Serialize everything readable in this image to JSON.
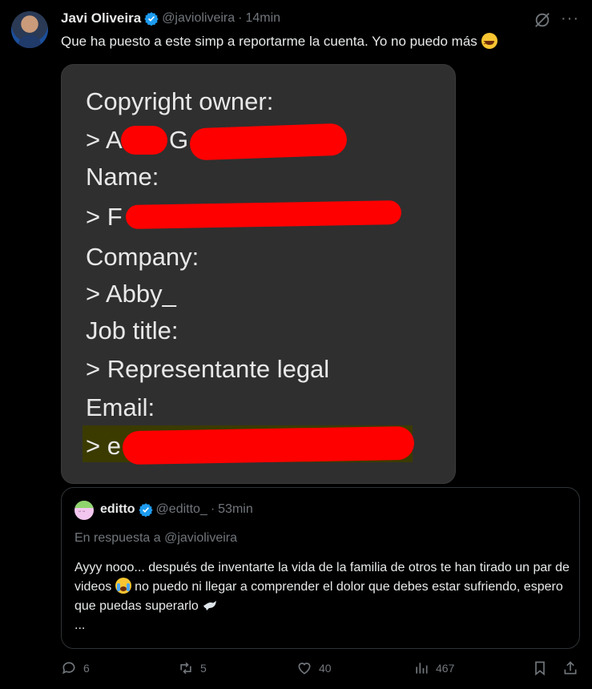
{
  "tweet": {
    "author_name": "Javi Oliveira",
    "author_handle": "@javioliveira",
    "separator": "·",
    "timestamp": "14min",
    "text": "Que ha puesto a este simp a reportarme la cuenta. Yo no puedo más",
    "emoji": "laughing-emoji"
  },
  "media": {
    "lines": [
      "Copyright owner:",
      "> A",
      "G",
      "Name:",
      "> F",
      "Company:",
      "> Abby_",
      "Job title:",
      "> Representante legal",
      "Email:",
      "> e"
    ],
    "redaction_color": "#ff0000"
  },
  "quote": {
    "author_name": "editto",
    "author_handle": "@editto_",
    "separator": "·",
    "timestamp": "53min",
    "reply_to": "En respuesta a @javioliveira",
    "text_part1": "Ayyy nooo... después de inventarte la vida de la familia de otros te han tirado un par de videos",
    "text_part2": " no puedo ni llegar a comprender el dolor que debes estar sufriendo, espero que puedas superarlo",
    "text_more": "..."
  },
  "actions": {
    "replies": "6",
    "retweets": "5",
    "likes": "40",
    "views": "467"
  },
  "colors": {
    "background": "#000000",
    "text": "#e7e9ea",
    "muted": "#71767b",
    "verified": "#1d9bf0"
  }
}
